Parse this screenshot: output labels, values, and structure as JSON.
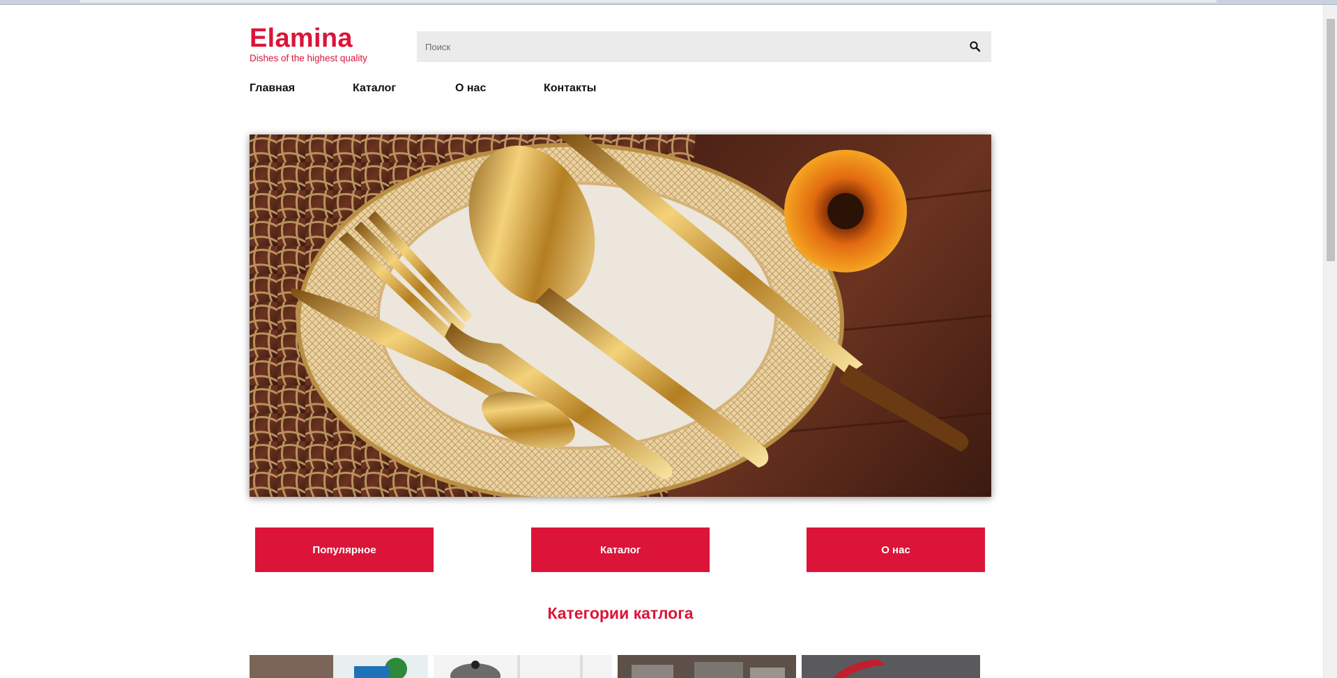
{
  "brand": {
    "title": "Elamina",
    "tagline": "Dishes of the highest quality",
    "accent_color": "#dc1439"
  },
  "search": {
    "placeholder": "Поиск",
    "icon": "search-icon"
  },
  "nav": {
    "items": [
      {
        "label": "Главная"
      },
      {
        "label": "Каталог"
      },
      {
        "label": "О нас"
      },
      {
        "label": "Контакты"
      }
    ]
  },
  "hero": {
    "image": "gold-cutlery-on-plate-photo"
  },
  "buttons": {
    "popular": "Популярное",
    "catalog": "Каталог",
    "about": "О нас"
  },
  "categories": {
    "title": "Категории катлога",
    "items": [
      {
        "image": "category-photo-1"
      },
      {
        "image": "category-photo-2"
      },
      {
        "image": "category-photo-3"
      },
      {
        "image": "category-photo-4"
      }
    ]
  }
}
